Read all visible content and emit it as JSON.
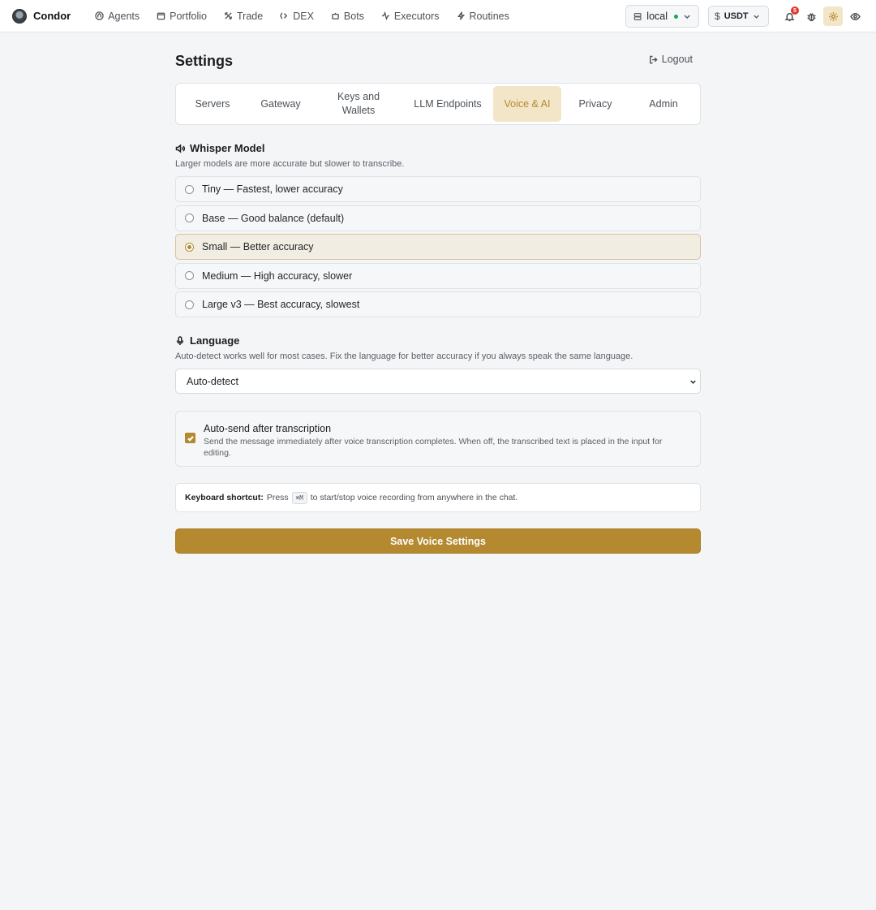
{
  "app": {
    "name": "Condor"
  },
  "nav": {
    "items": [
      {
        "label": "Agents",
        "icon": "agents-icon"
      },
      {
        "label": "Portfolio",
        "icon": "wallet-icon"
      },
      {
        "label": "Trade",
        "icon": "trade-icon"
      },
      {
        "label": "DEX",
        "icon": "dex-icon"
      },
      {
        "label": "Bots",
        "icon": "bot-icon"
      },
      {
        "label": "Executors",
        "icon": "activity-icon"
      },
      {
        "label": "Routines",
        "icon": "bolt-icon"
      }
    ]
  },
  "topbar": {
    "server": "local",
    "server_status_color": "#22a35a",
    "currency": "USDT",
    "notifications_count": "5"
  },
  "page": {
    "title": "Settings",
    "logout_label": "Logout"
  },
  "tabs": [
    {
      "label": "Servers"
    },
    {
      "label": "Gateway"
    },
    {
      "label": "Keys and Wallets"
    },
    {
      "label": "LLM Endpoints"
    },
    {
      "label": "Voice & AI",
      "active": true
    },
    {
      "label": "Privacy"
    },
    {
      "label": "Admin"
    }
  ],
  "whisper": {
    "title": "Whisper Model",
    "description": "Larger models are more accurate but slower to transcribe.",
    "options": [
      {
        "label": "Tiny — Fastest, lower accuracy",
        "selected": false
      },
      {
        "label": "Base — Good balance (default)",
        "selected": false
      },
      {
        "label": "Small — Better accuracy",
        "selected": true
      },
      {
        "label": "Medium — High accuracy, slower",
        "selected": false
      },
      {
        "label": "Large v3 — Best accuracy, slowest",
        "selected": false
      }
    ]
  },
  "language": {
    "title": "Language",
    "description": "Auto-detect works well for most cases. Fix the language for better accuracy if you always speak the same language.",
    "selected": "Auto-detect"
  },
  "autosend": {
    "checked": true,
    "title": "Auto-send after transcription",
    "description": "Send the message immediately after voice transcription completes. When off, the transcribed text is placed in the input for editing."
  },
  "shortcut": {
    "label": "Keyboard shortcut:",
    "prefix": "Press",
    "key": "⌘M",
    "suffix": "to start/stop voice recording from anywhere in the chat."
  },
  "save_button": "Save Voice Settings",
  "colors": {
    "accent": "#b4892f",
    "accent_bg": "#f3e6c8",
    "page_bg": "#f4f5f7"
  }
}
